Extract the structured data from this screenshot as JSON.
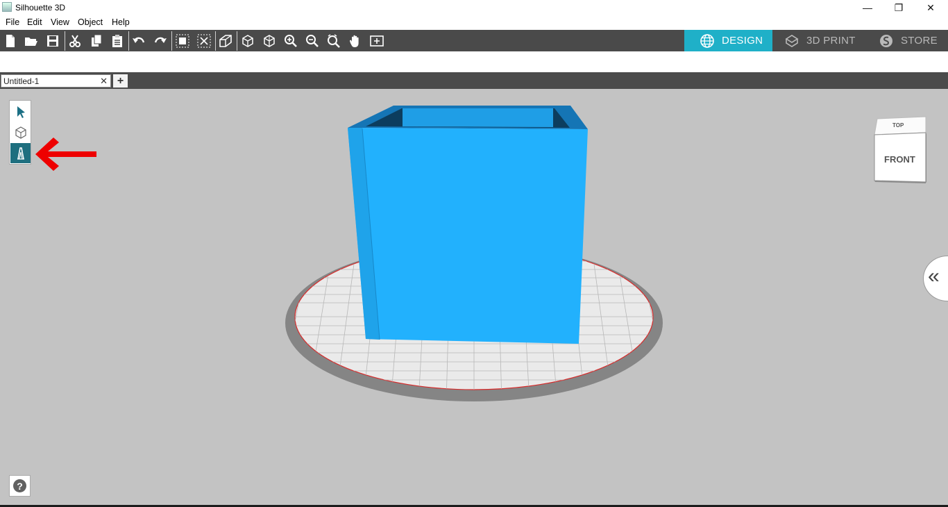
{
  "window": {
    "title": "Silhouette 3D",
    "minimize_glyph": "—",
    "restore_glyph": "❐",
    "close_glyph": "✕"
  },
  "menu": [
    "File",
    "Edit",
    "View",
    "Object",
    "Help"
  ],
  "toolbar": {
    "icons": [
      "new-file-icon",
      "open-folder-icon",
      "save-icon",
      "cut-icon",
      "copy-icon",
      "paste-icon",
      "undo-icon",
      "redo-icon",
      "group-icon",
      "ungroup-icon",
      "extrude-view-icon",
      "cube-view-icon",
      "cube-alt-view-icon",
      "zoom-in-icon",
      "zoom-out-icon",
      "zoom-fit-icon",
      "pan-hand-icon",
      "fit-screen-icon"
    ]
  },
  "modes": [
    {
      "label": "DESIGN",
      "icon": "globe-icon",
      "active": true
    },
    {
      "label": "3D PRINT",
      "icon": "print-icon",
      "active": false
    },
    {
      "label": "STORE",
      "icon": "store-icon",
      "active": false
    }
  ],
  "tabs": {
    "document": "Untitled-1",
    "close_glyph": "✕",
    "add_glyph": "+"
  },
  "side_tools": [
    "select-arrow-icon",
    "cube-icon",
    "text-a-icon"
  ],
  "viewcube": {
    "top": "TOP",
    "front": "FRONT"
  },
  "help_glyph": "?",
  "collapse_glyph": "«",
  "colors": {
    "accent": "#1fb0c8",
    "model": "#22b1fd",
    "viewport": "#c3c3c3",
    "toolbar": "#4a4a4a",
    "annotation_arrow": "#ee0000"
  }
}
